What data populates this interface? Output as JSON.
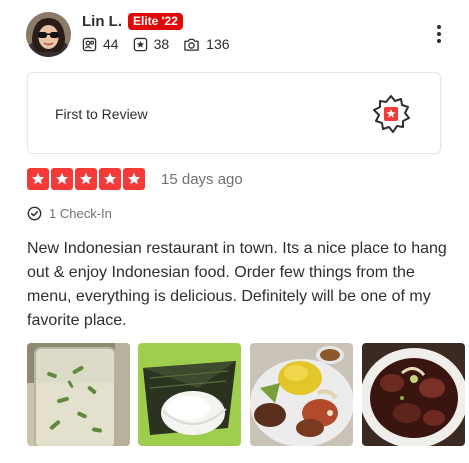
{
  "user": {
    "name": "Lin L.",
    "elite_badge": "Elite '22",
    "friends_count": "44",
    "reviews_count": "38",
    "photos_count": "136"
  },
  "icons": {
    "friends": "friends-icon",
    "reviews": "review-star-icon",
    "photos": "camera-icon",
    "more": "more-vertical-icon",
    "checkin": "check-circle-icon",
    "first_to_review": "first-to-review-badge-icon"
  },
  "highlight": {
    "title": "First to Review"
  },
  "review": {
    "rating": 5,
    "max_rating": 5,
    "date": "15 days ago",
    "checkin": "1 Check-In",
    "text": "New Indonesian restaurant in town. Its a nice place to hang out & enjoy Indonesian food. Order few things from the menu, everything is delicious. Definitely will be one of my favorite place."
  },
  "photos": [
    {
      "name": "photo-iced-drink"
    },
    {
      "name": "photo-wrapped-rice"
    },
    {
      "name": "photo-yellow-rice-plate"
    },
    {
      "name": "photo-beef-soup"
    }
  ],
  "colors": {
    "brand_red": "#e00707",
    "star_red": "#f43939",
    "text_dark": "#2d2e2f",
    "text_muted": "#6e7072"
  }
}
